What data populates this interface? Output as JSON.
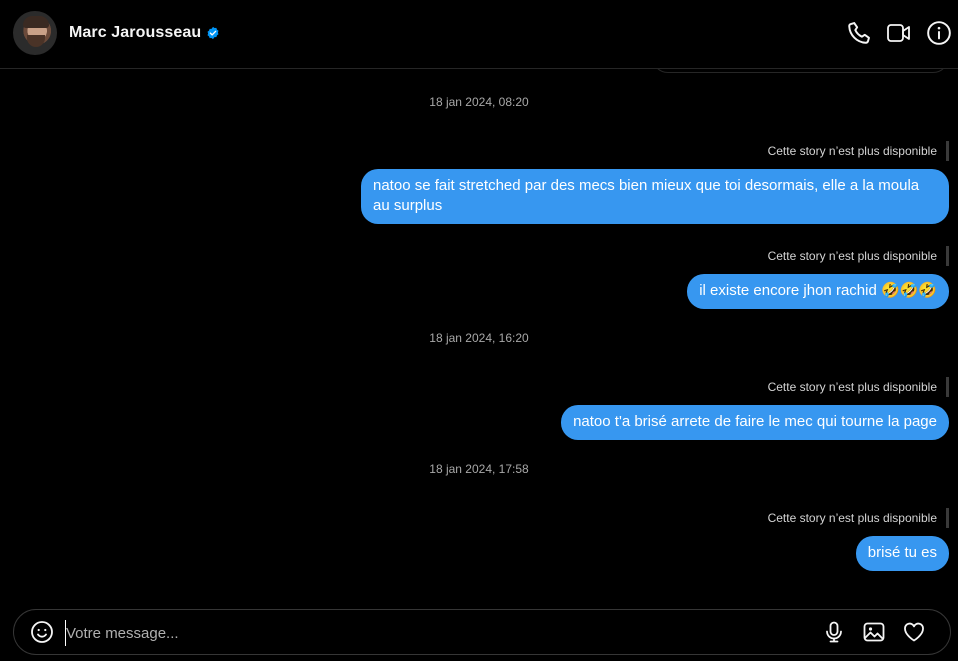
{
  "header": {
    "contact_name": "Marc Jarousseau",
    "verified": true,
    "icons": [
      "phone-icon",
      "video-call-icon",
      "info-icon"
    ]
  },
  "messages": {
    "timestamp_1": "18 jan 2024, 08:20",
    "story_note_1": "Cette story n’est plus disponible",
    "bubble_1": "natoo se fait stretched par des mecs bien mieux que toi desormais, elle a la moula au surplus",
    "story_note_2": "Cette story n’est plus disponible",
    "bubble_2": "il existe encore jhon rachid 🤣🤣🤣",
    "timestamp_2": "18 jan 2024, 16:20",
    "story_note_3": "Cette story n’est plus disponible",
    "bubble_3": "natoo t'a brisé arrete de faire le mec qui tourne la page",
    "timestamp_3": "18 jan 2024, 17:58",
    "story_note_4": "Cette story n’est plus disponible",
    "bubble_4": "brisé tu es"
  },
  "composer": {
    "placeholder": "Votre message...",
    "value": "",
    "icons": [
      "emoji-icon",
      "microphone-icon",
      "image-icon",
      "heart-icon"
    ]
  },
  "colors": {
    "background": "#000000",
    "bubble": "#3797f0",
    "verified": "#0095f6",
    "muted_text": "#a8a8a8",
    "border": "#262626"
  }
}
